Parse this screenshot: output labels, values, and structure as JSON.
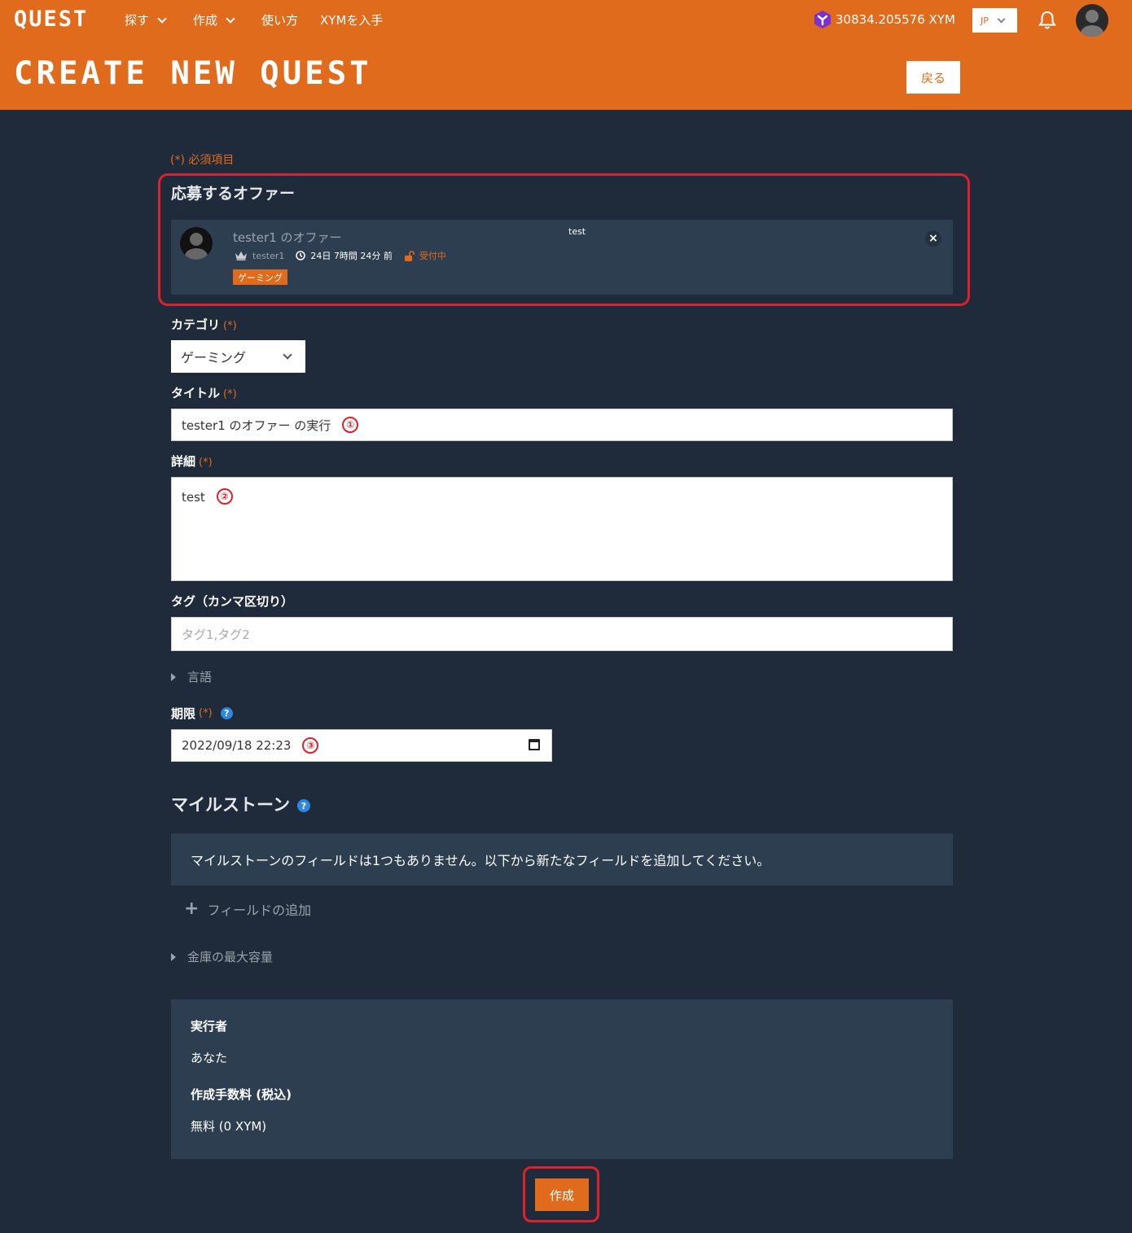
{
  "header": {
    "logo": "QUEST",
    "nav": [
      {
        "label": "探す",
        "dropdown": true
      },
      {
        "label": "作成",
        "dropdown": true
      },
      {
        "label": "使い方",
        "dropdown": false
      },
      {
        "label": "XYMを入手",
        "dropdown": false
      }
    ],
    "balance": "30834.205576 XYM",
    "language": "JP",
    "page_title": "CREATE NEW QUEST",
    "back_label": "戻る"
  },
  "form": {
    "required_note": "(*) 必須項目",
    "required_mark": "(*)",
    "offer_heading": "応募するオファー",
    "offer": {
      "title": "tester1 のオファー",
      "description": "test",
      "user": "tester1",
      "time_left": "24日 7時間 24分 前",
      "status": "受付中",
      "category_tag": "ゲーミング",
      "close": "×"
    },
    "category_label": "カテゴリ",
    "category_value": "ゲーミング",
    "title_label": "タイトル",
    "title_value": "tester1 のオファー の実行",
    "title_marker": "①",
    "detail_label": "詳細",
    "detail_value": "test",
    "detail_marker": "②",
    "tags_label": "タグ（カンマ区切り）",
    "tags_placeholder": "タグ1,タグ2",
    "language_label": "言語",
    "deadline_label": "期限",
    "deadline_value": "2022/09/18 22:23",
    "deadline_marker": "③",
    "milestone_heading": "マイルストーン",
    "milestone_empty": "マイルストーンのフィールドは1つもありません。以下から新たなフィールドを追加してください。",
    "add_field": "フィールドの追加",
    "vault_label": "金庫の最大容量",
    "summary": {
      "executor_label": "実行者",
      "executor_value": "あなた",
      "fee_label": "作成手数料 (税込)",
      "fee_value": "無料 (0 XYM)"
    },
    "create_label": "作成"
  },
  "colors": {
    "accent": "#e06b1c",
    "background": "#1f2b3a",
    "panel": "#2d3e50",
    "highlight": "#e0202a"
  }
}
